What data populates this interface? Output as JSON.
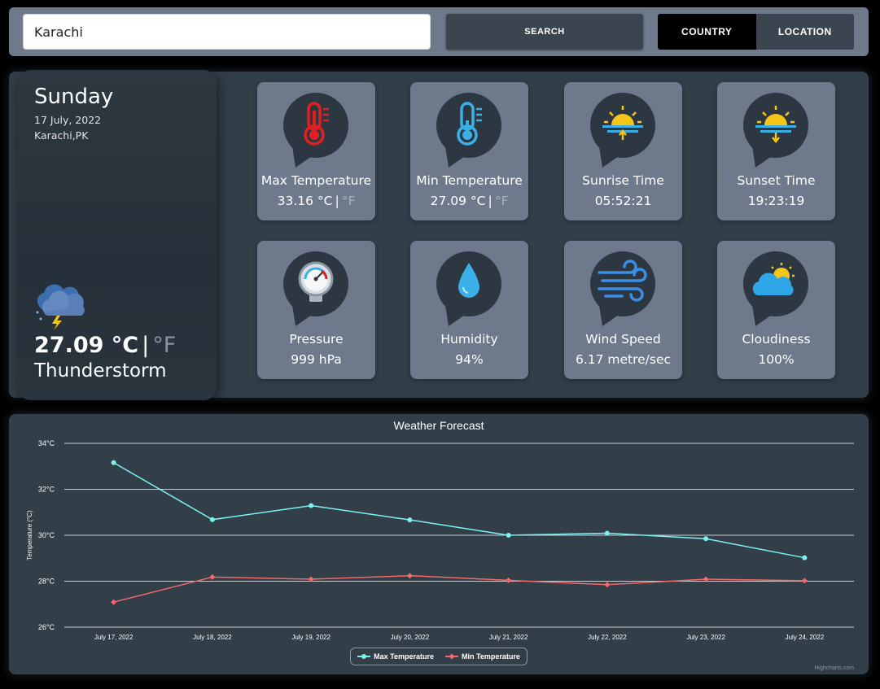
{
  "search": {
    "value": "Karachi",
    "button_label": "SEARCH"
  },
  "toggle": {
    "country_label": "COUNTRY",
    "location_label": "LOCATION",
    "active": "country"
  },
  "today": {
    "day": "Sunday",
    "date": "17 July, 2022",
    "location": "Karachi,PK",
    "temp": "27.09 °C",
    "sep": "|",
    "unit_f": "°F",
    "description": "Thunderstorm",
    "icon": "thunderstorm-icon"
  },
  "stats": [
    {
      "label": "Max Temperature",
      "value": "33.16 °C",
      "sep": "|",
      "alt": "°F",
      "icon": "thermometer-hot-icon"
    },
    {
      "label": "Min Temperature",
      "value": "27.09 °C",
      "sep": "|",
      "alt": "°F",
      "icon": "thermometer-cold-icon"
    },
    {
      "label": "Sunrise Time",
      "value": "05:52:21",
      "icon": "sunrise-icon"
    },
    {
      "label": "Sunset Time",
      "value": "19:23:19",
      "icon": "sunset-icon"
    },
    {
      "label": "Pressure",
      "value": "999 hPa",
      "icon": "pressure-gauge-icon"
    },
    {
      "label": "Humidity",
      "value": "94%",
      "icon": "water-drop-icon"
    },
    {
      "label": "Wind Speed",
      "value": "6.17 metre/sec",
      "icon": "wind-icon"
    },
    {
      "label": "Cloudiness",
      "value": "100%",
      "icon": "cloud-sun-icon"
    }
  ],
  "colors": {
    "max_series": "#7cf3f0",
    "min_series": "#f26a6a",
    "panel": "#323e48",
    "card": "#6e7a8c"
  },
  "credit": "Highcharts.com",
  "chart_data": {
    "type": "line",
    "title": "Weather Forecast",
    "xlabel": "",
    "ylabel": "Temperature (°C)",
    "ylim": [
      26,
      34
    ],
    "yticks": [
      26,
      28,
      30,
      32,
      34
    ],
    "ytick_suffix": "°C",
    "grid": true,
    "legend": "bottom-center",
    "categories": [
      "July 17, 2022",
      "July 18, 2022",
      "July 19, 2022",
      "July 20, 2022",
      "July 21, 2022",
      "July 22, 2022",
      "July 23, 2022",
      "July 24, 2022"
    ],
    "series": [
      {
        "name": "Max Temperature",
        "color": "#7cf3f0",
        "marker": "circle",
        "values": [
          33.16,
          30.68,
          31.29,
          30.67,
          30.0,
          30.09,
          29.85,
          29.02
        ]
      },
      {
        "name": "Min Temperature",
        "color": "#f26a6a",
        "marker": "diamond",
        "values": [
          27.09,
          28.18,
          28.09,
          28.24,
          28.04,
          27.85,
          28.09,
          28.02
        ]
      }
    ]
  }
}
